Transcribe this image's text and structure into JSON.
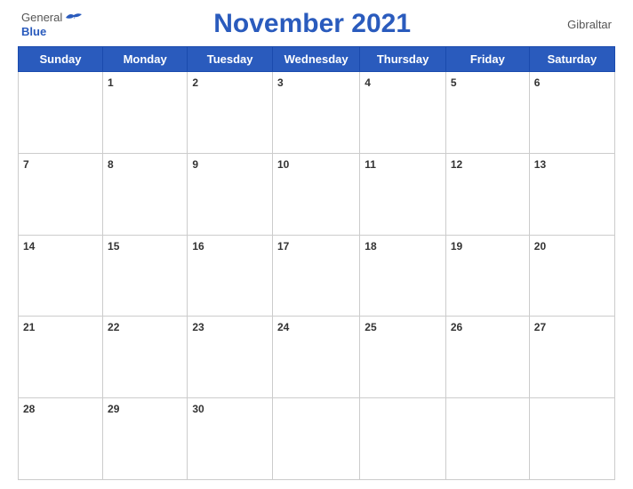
{
  "header": {
    "logo_general": "General",
    "logo_blue": "Blue",
    "title": "November 2021",
    "country": "Gibraltar"
  },
  "weekdays": [
    "Sunday",
    "Monday",
    "Tuesday",
    "Wednesday",
    "Thursday",
    "Friday",
    "Saturday"
  ],
  "weeks": [
    [
      null,
      1,
      2,
      3,
      4,
      5,
      6
    ],
    [
      7,
      8,
      9,
      10,
      11,
      12,
      13
    ],
    [
      14,
      15,
      16,
      17,
      18,
      19,
      20
    ],
    [
      21,
      22,
      23,
      24,
      25,
      26,
      27
    ],
    [
      28,
      29,
      30,
      null,
      null,
      null,
      null
    ]
  ]
}
